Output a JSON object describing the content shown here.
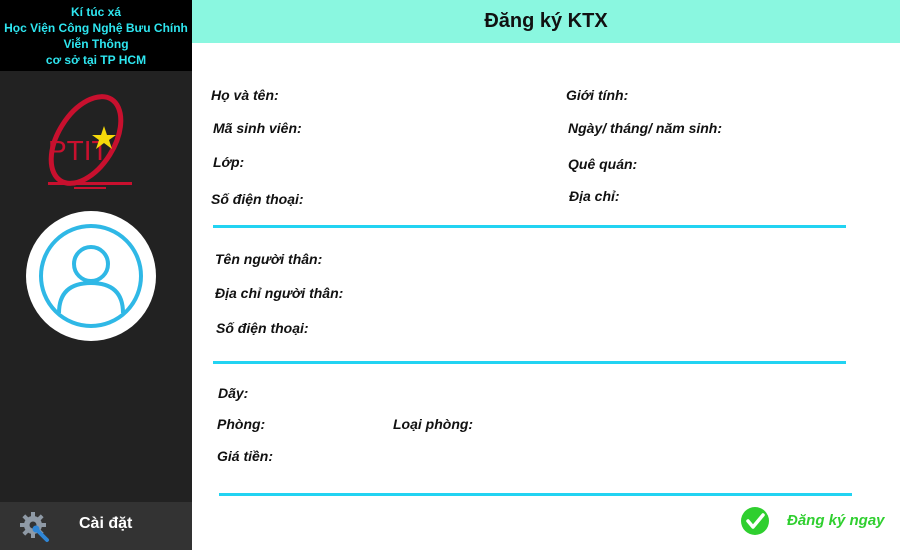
{
  "sidebar": {
    "header_lines": [
      "Kí túc xá",
      "Học Viện Công Nghệ Bưu Chính",
      "Viễn Thông",
      "cơ sở tại TP HCM"
    ],
    "logo_text": "PTIT",
    "settings_label": "Cài đặt"
  },
  "header": {
    "title": "Đăng ký KTX"
  },
  "student": {
    "name_label": "Họ và tên:",
    "student_id_label": "Mã sinh viên:",
    "class_label": "Lớp:",
    "phone_label": "Số điện thoại:",
    "gender_label": "Giới tính:",
    "dob_label": "Ngày/ tháng/ năm sinh:",
    "hometown_label": "Quê quán:",
    "address_label": "Địa chỉ:"
  },
  "relative": {
    "name_label": "Tên người thân:",
    "address_label": "Địa chỉ người thân:",
    "phone_label": "Số điện thoại:"
  },
  "room": {
    "block_label": "Dãy:",
    "room_label": "Phòng:",
    "room_type_label": "Loại phòng:",
    "price_label": "Giá tiền:"
  },
  "actions": {
    "register_label": "Đăng ký ngay"
  },
  "colors": {
    "accent": "#22d3f2",
    "header_bg": "#8af7e0",
    "success": "#2fcf2f",
    "sidebar_bg": "#222222"
  },
  "icons": {
    "settings": "gear-icon",
    "avatar": "user-icon",
    "register": "check-circle-icon"
  }
}
